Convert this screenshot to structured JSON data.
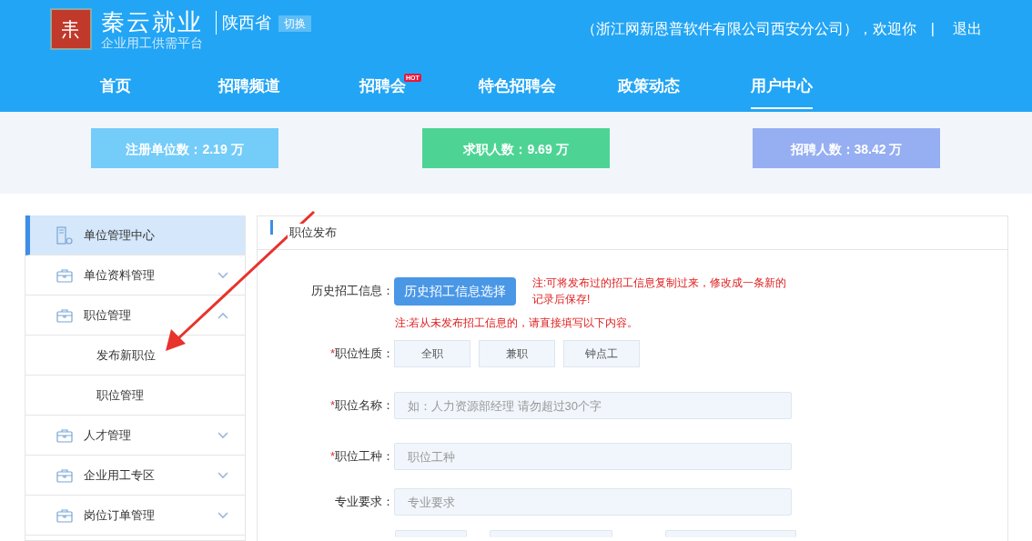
{
  "header": {
    "logo_title": "秦云就业",
    "logo_subtitle": "企业用工供需平台",
    "province": "陕西省",
    "switch_button": "切换",
    "welcome": "（浙江网新恩普软件有限公司西安分公司），欢迎你",
    "separator": "|",
    "logout": "退出"
  },
  "nav": [
    {
      "label": "首页",
      "selected": false
    },
    {
      "label": "招聘频道",
      "selected": false
    },
    {
      "label": "招聘会",
      "selected": false,
      "badge": "HOT"
    },
    {
      "label": "特色招聘会",
      "selected": false
    },
    {
      "label": "政策动态",
      "selected": false
    },
    {
      "label": "用户中心",
      "selected": true
    }
  ],
  "stats": [
    {
      "label": "注册单位数：2.19 万",
      "color": "#74ccf9"
    },
    {
      "label": "求职人数：9.69 万",
      "color": "#4dd494"
    },
    {
      "label": "招聘人数：38.42 万",
      "color": "#96aef2"
    }
  ],
  "sidebar": {
    "items": [
      {
        "label": "单位管理中心",
        "kind": "home",
        "selected": true
      },
      {
        "label": "单位资料管理",
        "kind": "group",
        "selected": false,
        "expanded": false
      },
      {
        "label": "职位管理",
        "kind": "group",
        "selected": false,
        "expanded": true,
        "children": [
          {
            "label": "发布新职位",
            "selected": false
          },
          {
            "label": "职位管理",
            "selected": false
          }
        ]
      },
      {
        "label": "人才管理",
        "kind": "group",
        "selected": false,
        "expanded": false
      },
      {
        "label": "企业用工专区",
        "kind": "group",
        "selected": false,
        "expanded": false
      },
      {
        "label": "岗位订单管理",
        "kind": "group",
        "selected": false,
        "expanded": false
      }
    ]
  },
  "panel": {
    "title": "职位发布",
    "history": {
      "label": "历史招工信息：",
      "button": "历史招工信息选择",
      "note": "注:可将发布过的招工信息复制过来，修改成一条新的记录后保存!",
      "note2": "注:若从未发布招工信息的，请直接填写以下内容。"
    },
    "job_type": {
      "mark": "*",
      "label": "职位性质：",
      "options": [
        {
          "label": "全职",
          "selected": false
        },
        {
          "label": "兼职",
          "selected": false
        },
        {
          "label": "钟点工",
          "selected": false
        }
      ]
    },
    "fields": [
      {
        "mark": "*",
        "label": "职位名称：",
        "placeholder": "如：人力资源部经理 请勿超过30个字"
      },
      {
        "mark": "*",
        "label": "职位工种：",
        "placeholder": "职位工种"
      },
      {
        "label": "专业要求：",
        "placeholder": "专业要求"
      }
    ]
  }
}
